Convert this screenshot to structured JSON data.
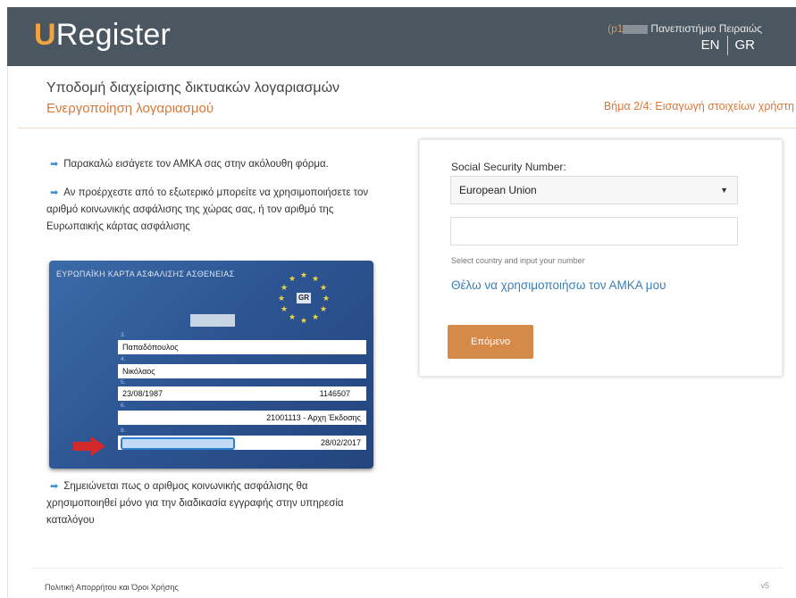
{
  "header": {
    "logo_u": "U",
    "logo_rest": "Register",
    "user_prefix": "(p1",
    "institution": "Πανεπιστήμιο Πειραιώς",
    "lang_en": "EN",
    "lang_gr": "GR"
  },
  "titles": {
    "main": "Υποδομή διαχείρισης δικτυακών λογαριασμών",
    "sub": "Ενεργοποίηση λογαριασμού",
    "step": "Βήμα 2/4: Εισαγωγή στοιχείων χρήστη"
  },
  "instructions": {
    "p1": "Παρακαλώ εισάγετε τον ΑΜΚΑ σας στην ακόλουθη φόρμα.",
    "p2": "Αν προέρχεστε από το εξωτερικό μπορείτε να χρησιμοποιήσετε τον αριθμό κοινωνικής ασφάλισης της χώρας σας, ή τον αριθμό της Ευρωπαικής κάρτας ασφάλισης",
    "p3": "Σημειώνεται πως ο αριθμος κοινωνικής ασφάλισης θα χρησιμοποιηθεί μόνο για την διαδικασία εγγραφής στην υπηρεσία καταλόγου"
  },
  "card": {
    "title": "ΕΥΡΩΠΑΪΚΗ ΚΑΡΤΑ ΑΣΦΑΛΙΣΗΣ ΑΣΘΕΝΕΙΑΣ",
    "country": "GR",
    "surname": "Παπαδόπουλος",
    "name": "Νικόλαος",
    "birthdate": "23/08/1987",
    "personal_id": "1146507",
    "institution": "21001113 - Αρχη Έκδοσης",
    "expiry": "28/02/2017"
  },
  "form": {
    "ssn_label": "Social Security Number:",
    "country_select": "European Union",
    "ssn_value": "",
    "hint": "Select country and input your number",
    "amka_link": "Θέλω να χρησιμοποιήσω τον ΑΜΚΑ μου",
    "next_button": "Επόμενο"
  },
  "footer": {
    "policy": "Πολιτική Απορρήτου και Όροι Χρήσης",
    "version": "v5"
  },
  "colors": {
    "topbar": "#4a5660",
    "accent": "#d8773a",
    "button": "#d58a4a",
    "link": "#3b7fb8"
  }
}
